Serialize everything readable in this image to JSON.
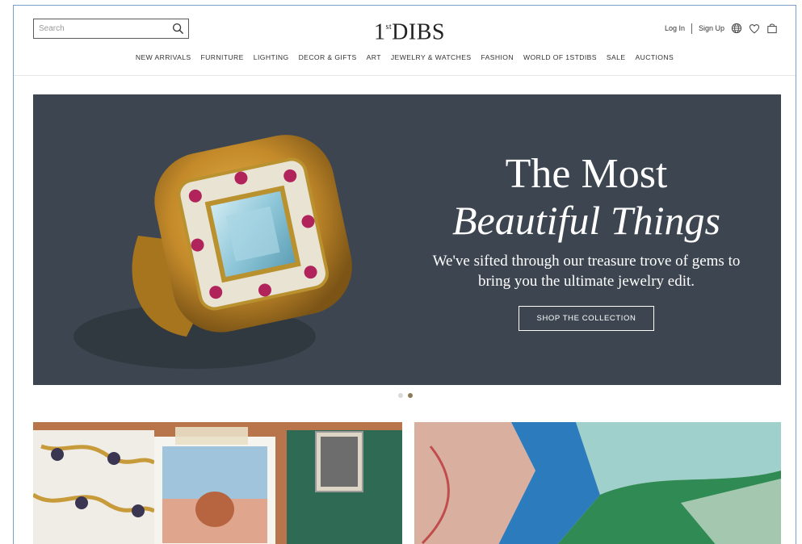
{
  "header": {
    "search_placeholder": "Search",
    "logo_main": "DIBS",
    "logo_prefix": "1",
    "logo_sup": "st",
    "login": "Log In",
    "signup": "Sign Up"
  },
  "nav": {
    "items": [
      "NEW ARRIVALS",
      "FURNITURE",
      "LIGHTING",
      "DECOR & GIFTS",
      "ART",
      "JEWELRY & WATCHES",
      "FASHION",
      "WORLD OF 1STDIBS",
      "SALE",
      "AUCTIONS"
    ]
  },
  "hero": {
    "title_line1": "The Most",
    "title_line2": "Beautiful Things",
    "subtitle_line1": "We've sifted through our treasure trove of gems to",
    "subtitle_line2": "bring you the ultimate jewelry edit.",
    "cta": "SHOP THE COLLECTION"
  },
  "carousel": {
    "current_slide": 2,
    "total_slides": 2
  },
  "colors": {
    "hero_bg": "#3d4650",
    "accent_dot": "#8a7a55",
    "gold": "#c9952f"
  },
  "icons": [
    "search-icon",
    "globe-icon",
    "heart-icon",
    "bag-icon"
  ]
}
